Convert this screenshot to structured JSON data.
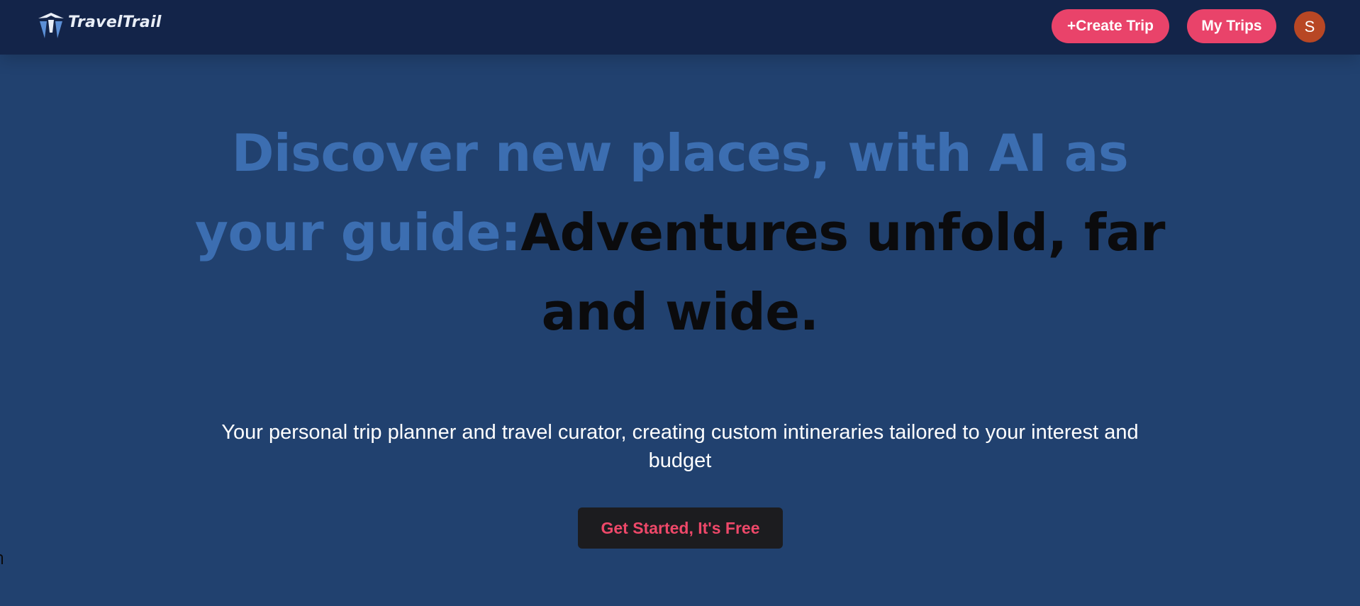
{
  "brand": {
    "logo_text": "TravelTrail",
    "logo_icon": "tt-mark-icon"
  },
  "nav": {
    "create_trip_label": "+Create Trip",
    "my_trips_label": "My Trips",
    "avatar_initial": "S"
  },
  "hero": {
    "headline_accent": "Discover new places, with AI as your guide:",
    "headline_main": "Adventures unfold, far and wide.",
    "subtitle": "Your personal trip planner and travel curator, creating custom intineraries tailored to your interest and budget",
    "cta_label": "Get Started, It's Free"
  },
  "colors": {
    "background": "#21416f",
    "navbar": "#132449",
    "accent_pink": "#e9436a",
    "headline_accent": "#3c6eb1",
    "headline_dark": "#0b0b0d",
    "avatar": "#b84724",
    "cta_background": "#1c1c1f"
  }
}
